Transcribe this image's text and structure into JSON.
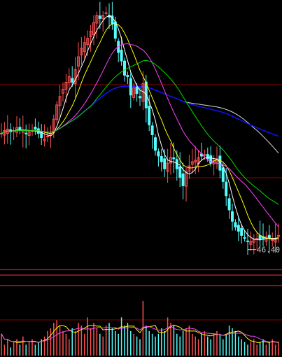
{
  "chart_data": {
    "type": "candlestick",
    "annotation": "46.40",
    "colors": {
      "background": "#000000",
      "up": "#ff5050",
      "down": "#54fcfc",
      "grid": "#8b0000",
      "separator": "#ff3030",
      "ma5": "#ffffff",
      "ma10": "#ffff00",
      "ma20": "#ff44ff",
      "ma30": "#00dd00",
      "ma60": "#d8d8d8",
      "ma120": "#1010ff"
    },
    "closes": [
      54.6,
      54.8,
      54.9,
      54.7,
      54.8,
      55.0,
      54.9,
      54.8,
      54.6,
      54.7,
      54.8,
      54.9,
      54.6,
      54.3,
      54.2,
      54.4,
      54.6,
      55.6,
      56.6,
      57.2,
      57.7,
      58.2,
      58.6,
      58.2,
      59.1,
      60.0,
      60.6,
      61.0,
      61.3,
      61.8,
      62.4,
      62.9,
      62.7,
      62.9,
      63.1,
      62.8,
      62.3,
      61.3,
      60.3,
      59.7,
      58.7,
      58.6,
      57.3,
      57.8,
      57.4,
      57.1,
      58.1,
      56.4,
      55.2,
      54.5,
      53.4,
      53.0,
      52.6,
      52.1,
      52.5,
      52.9,
      52.8,
      52.1,
      51.5,
      50.9,
      51.9,
      52.3,
      52.6,
      52.7,
      52.9,
      53.0,
      53.1,
      52.8,
      52.5,
      52.7,
      52.8,
      52.0,
      51.2,
      50.2,
      49.2,
      48.4,
      48.0,
      47.7,
      47.4,
      47.2,
      47.0,
      47.0,
      47.1,
      47.2,
      47.1,
      47.2,
      47.3,
      47.2,
      47.1,
      47.2,
      47.4
    ],
    "volumes": [
      0.4,
      0.2,
      0.3,
      0.15,
      0.25,
      0.3,
      0.2,
      0.35,
      0.2,
      0.25,
      0.3,
      0.2,
      0.25,
      0.3,
      0.35,
      0.45,
      0.5,
      0.6,
      0.65,
      0.55,
      0.45,
      0.4,
      0.3,
      0.5,
      0.45,
      0.6,
      0.55,
      0.4,
      0.7,
      0.5,
      0.6,
      0.5,
      0.4,
      0.35,
      0.55,
      0.6,
      0.5,
      0.45,
      0.4,
      0.7,
      0.55,
      0.6,
      0.45,
      0.4,
      0.35,
      0.3,
      1.0,
      0.55,
      0.45,
      0.4,
      0.35,
      0.4,
      0.5,
      0.45,
      0.7,
      0.6,
      0.55,
      0.4,
      0.35,
      0.45,
      0.5,
      0.55,
      0.4,
      0.35,
      0.3,
      0.4,
      0.45,
      0.35,
      0.3,
      0.4,
      0.45,
      0.4,
      0.3,
      0.4,
      0.55,
      0.5,
      0.45,
      0.35,
      0.3,
      0.25,
      0.2,
      0.25,
      0.3,
      0.2,
      0.25,
      0.3,
      0.2,
      0.25,
      0.3,
      0.2,
      0.25
    ],
    "price_range": [
      45,
      64
    ],
    "moving_averages": [
      5,
      10,
      20,
      30,
      60,
      120
    ],
    "min_close_index": 80
  }
}
